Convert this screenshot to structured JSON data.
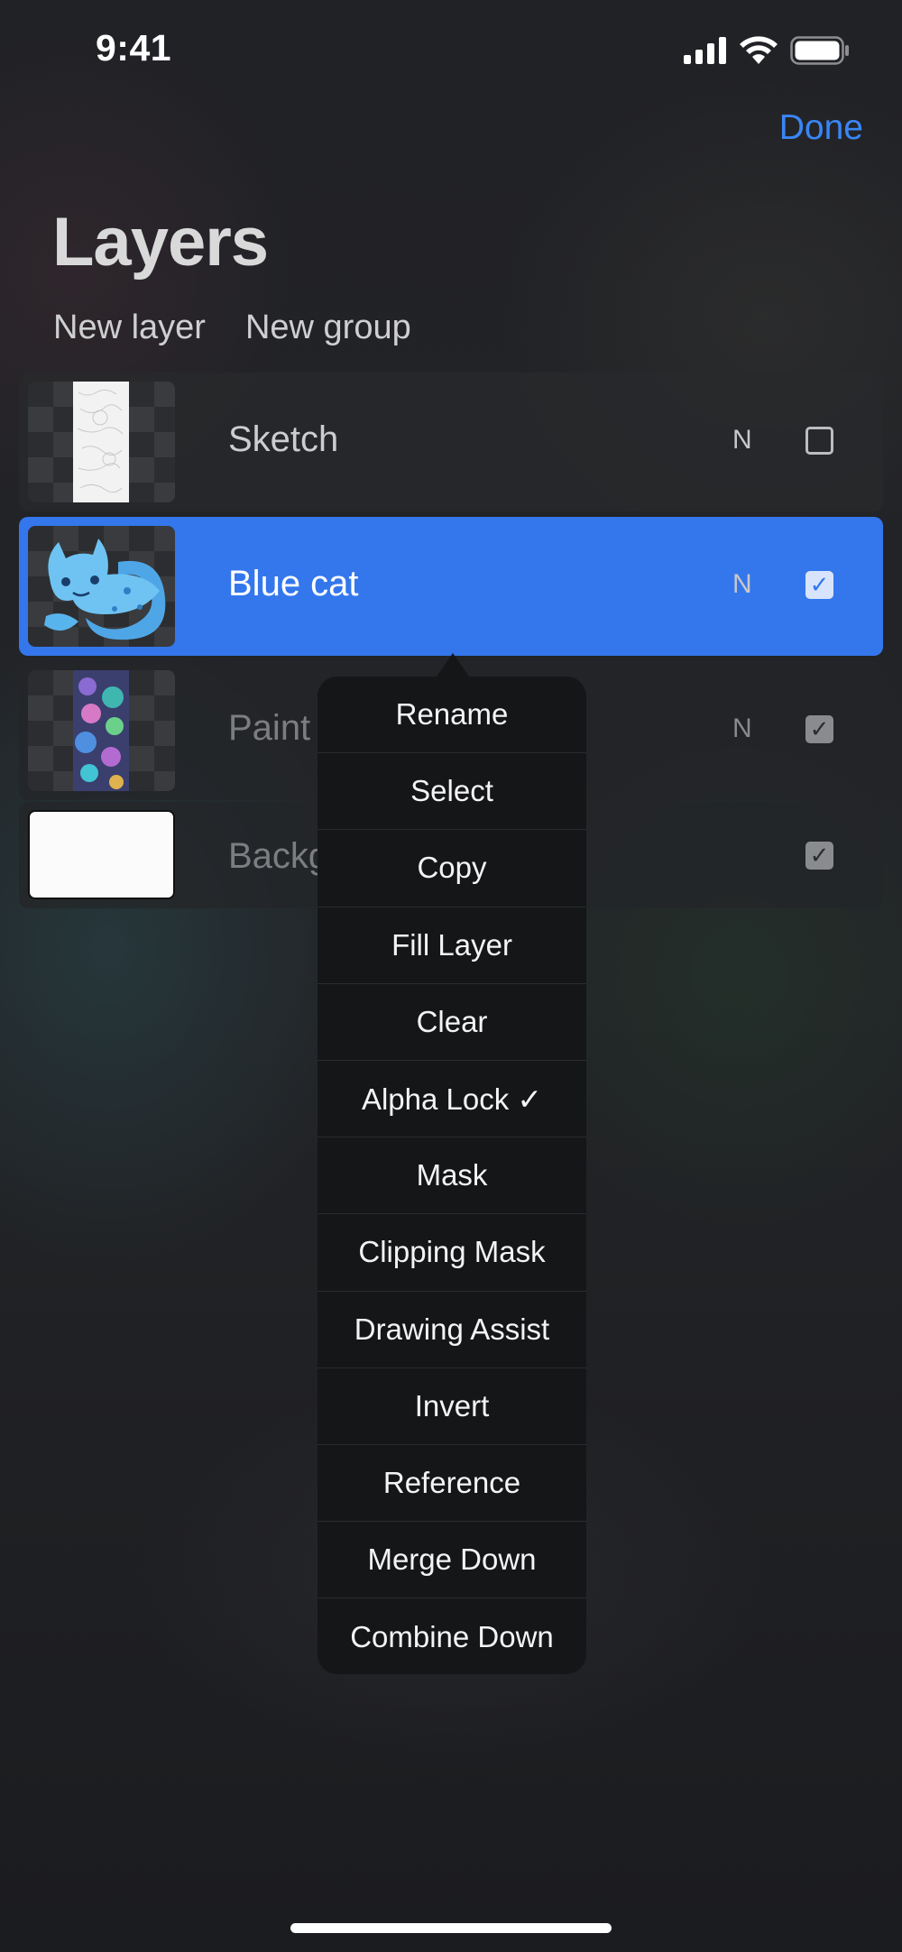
{
  "status_bar": {
    "time": "9:41"
  },
  "header": {
    "done_label": "Done",
    "title": "Layers",
    "new_layer_label": "New layer",
    "new_group_label": "New group"
  },
  "layers": [
    {
      "name": "Sketch",
      "blend_mode": "N",
      "visible": false,
      "selected": false
    },
    {
      "name": "Blue cat",
      "blend_mode": "N",
      "visible": true,
      "selected": true
    },
    {
      "name": "Paint",
      "blend_mode": "N",
      "visible": true,
      "selected": false
    },
    {
      "name": "Backg",
      "blend_mode": "",
      "visible": true,
      "selected": false
    }
  ],
  "context_menu": {
    "items": [
      "Rename",
      "Select",
      "Copy",
      "Fill Layer",
      "Clear",
      "Alpha Lock ✓",
      "Mask",
      "Clipping Mask",
      "Drawing Assist",
      "Invert",
      "Reference",
      "Merge Down",
      "Combine Down"
    ]
  },
  "colors": {
    "accent": "#3a86f5",
    "selected_row": "#3477ec",
    "menu_bg": "#151618"
  }
}
